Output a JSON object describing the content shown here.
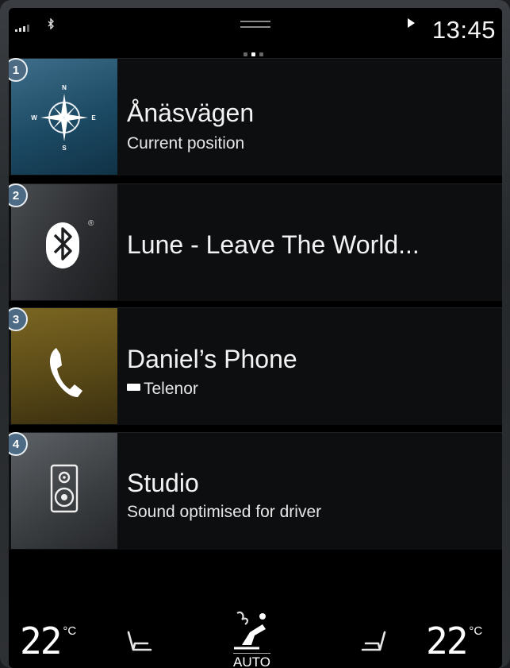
{
  "status_bar": {
    "clock": "13:45",
    "signal_icon": "signal-bars-icon",
    "bluetooth_icon": "bluetooth-icon",
    "navigation_icon": "navigation-arrow-icon"
  },
  "tiles": [
    {
      "number": "1",
      "title": "Ånäsvägen",
      "subtitle": "Current position",
      "icon": "compass-icon",
      "thumb_color": "#1c4a64",
      "compass": {
        "n": "N",
        "s": "S",
        "e": "E",
        "w": "W"
      }
    },
    {
      "number": "2",
      "title": "Lune - Leave The World...",
      "subtitle": "",
      "icon": "bluetooth-icon",
      "thumb_color": "#2a2c2f",
      "mark": "®"
    },
    {
      "number": "3",
      "title": "Daniel’s Phone",
      "subtitle": "Telenor",
      "icon": "phone-handset-icon",
      "thumb_color": "#5a4a17",
      "battery_icon": "battery-icon"
    },
    {
      "number": "4",
      "title": "Studio",
      "subtitle": "Sound optimised for driver",
      "icon": "speaker-icon",
      "thumb_color": "#3a3d40"
    }
  ],
  "climate": {
    "left_temp": "22",
    "right_temp": "22",
    "unit": "°C",
    "auto_label": "AUTO"
  }
}
